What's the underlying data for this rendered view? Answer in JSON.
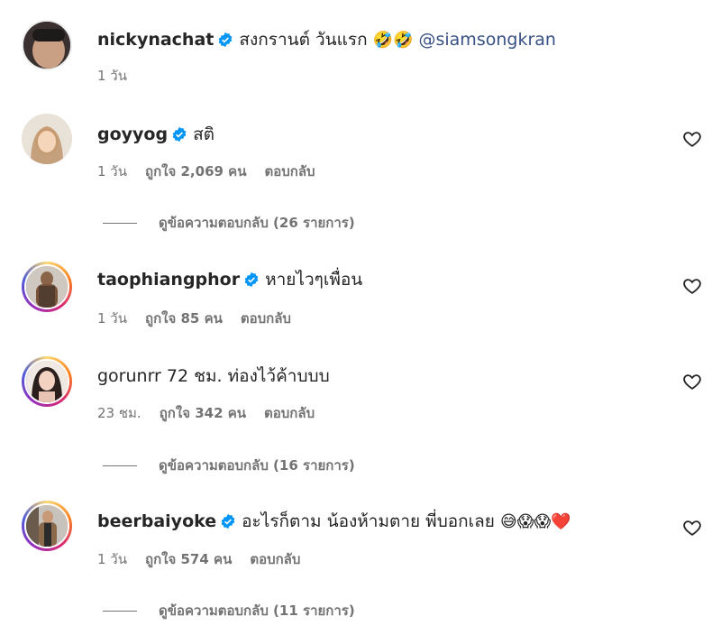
{
  "caption": {
    "username": "nickynachat",
    "text": "สงกรานต์ วันแรก",
    "emojis": "🤣🤣",
    "mention": "@siamsongkran",
    "time": "1 วัน"
  },
  "comments": [
    {
      "username": "goyyog",
      "text": "สติ",
      "time": "1 วัน",
      "likes": "ถูกใจ 2,069 คน",
      "reply": "ตอบกลับ",
      "view_replies": "ดูข้อความตอบกลับ (26 รายการ)"
    },
    {
      "username": "taophiangphor",
      "text": "หายไวๆเพื่อน",
      "time": "1 วัน",
      "likes": "ถูกใจ 85 คน",
      "reply": "ตอบกลับ"
    },
    {
      "username": "gorunrr",
      "text": "72 ชม. ท่องไว้ค้าบบบ",
      "time": "23 ชม.",
      "likes": "ถูกใจ 342 คน",
      "reply": "ตอบกลับ",
      "view_replies": "ดูข้อความตอบกลับ (16 รายการ)"
    },
    {
      "username": "beerbaiyoke",
      "text": "อะไรก็ตาม น้องห้ามตาย พี่บอกเลย",
      "emojis": "😅😱😱❤️",
      "time": "1 วัน",
      "likes": "ถูกใจ 574 คน",
      "reply": "ตอบกลับ",
      "view_replies": "ดูข้อความตอบกลับ (11 รายการ)"
    }
  ],
  "icons": {
    "verified": "verified-badge-icon",
    "like": "heart-outline-icon"
  },
  "colors": {
    "verified": "#0095f6",
    "mention": "#385185",
    "muted": "#737373"
  }
}
